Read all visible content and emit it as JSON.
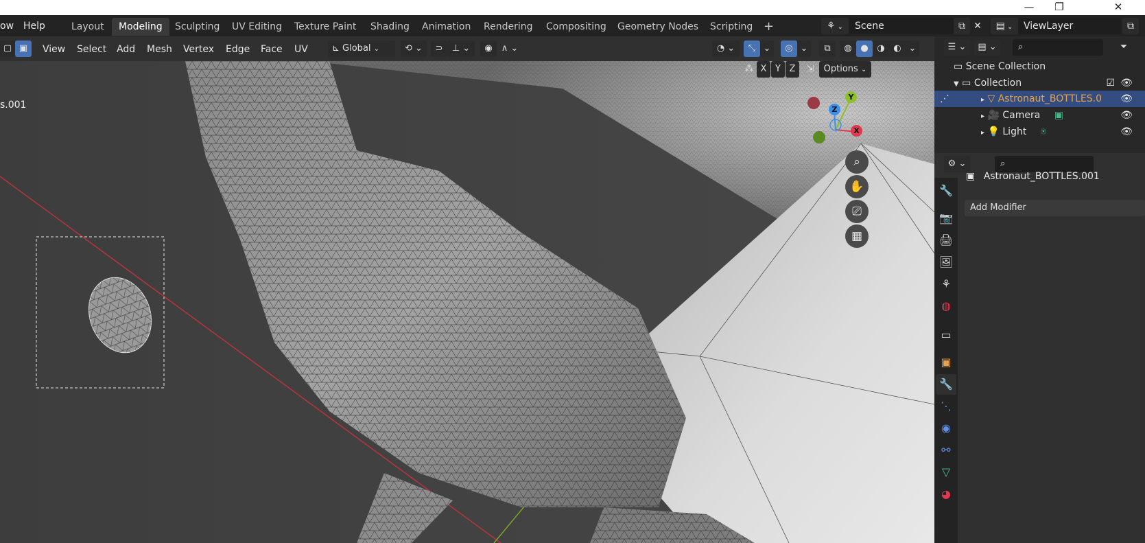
{
  "window": {
    "minimize": "—",
    "restore": "❐",
    "close": "✕"
  },
  "menus": {
    "window": "ow",
    "help": "Help"
  },
  "workspace_tabs": [
    "Layout",
    "Modeling",
    "Sculpting",
    "UV Editing",
    "Texture Paint",
    "Shading",
    "Animation",
    "Rendering",
    "Compositing",
    "Geometry Nodes",
    "Scripting"
  ],
  "active_tab": "Modeling",
  "add_tab": "+",
  "scene": {
    "name": "Scene",
    "view_layer": "ViewLayer"
  },
  "header": {
    "menus": [
      "View",
      "Select",
      "Add",
      "Mesh",
      "Vertex",
      "Edge",
      "Face",
      "UV"
    ],
    "transform_orientation": "Global",
    "axes": [
      "X",
      "Y",
      "Z"
    ],
    "options": "Options"
  },
  "viewport": {
    "object_label": "s.001",
    "gizmo": {
      "x": "X",
      "y": "Y",
      "z": "Z"
    }
  },
  "outliner": {
    "scene_collection": "Scene Collection",
    "collection": "Collection",
    "items": [
      {
        "name": "Astronaut_BOTTLES.0",
        "selected": true,
        "color": "#e8a24a"
      },
      {
        "name": "Camera",
        "selected": false,
        "color": "#e0e0e0"
      },
      {
        "name": "Light",
        "selected": false,
        "color": "#e0e0e0"
      }
    ]
  },
  "properties": {
    "object_name": "Astronaut_BOTTLES.001",
    "add_modifier": "Add Modifier"
  },
  "colors": {
    "accent": "#4772b3",
    "selected_text": "#e8a24a",
    "x_axis": "#e0384f",
    "y_axis": "#8bc12b",
    "z_axis": "#3d8fe8"
  }
}
